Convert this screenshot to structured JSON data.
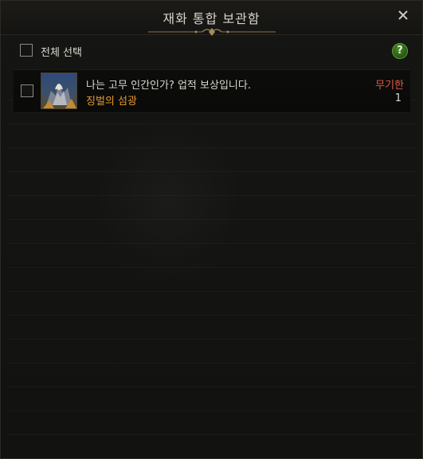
{
  "window": {
    "title": "재화 통합 보관함",
    "close_icon": "close-icon"
  },
  "toolbar": {
    "select_all_label": "전체 선택",
    "select_all_checked": false,
    "help_label": "?"
  },
  "items": [
    {
      "name": "나는 고무 인간인가? 업적 보상입니다.",
      "subtitle": "징벌의 섬광",
      "expiry": "무기한",
      "quantity": "1",
      "checked": false,
      "thumbnail_icon": "reward-thumbnail-icon"
    }
  ],
  "colors": {
    "title_text": "#d8d4cc",
    "subtitle_orange": "#e39a2e",
    "expiry_red": "#e25b47",
    "help_green": "#4a8a28"
  }
}
